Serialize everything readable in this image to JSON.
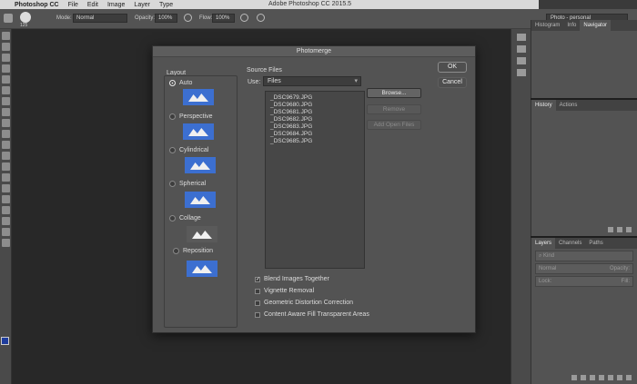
{
  "menubar": {
    "app_name": "Photoshop CC",
    "items": [
      "File",
      "Edit",
      "Image",
      "Layer",
      "Type"
    ],
    "window_title": "Adobe Photoshop CC 2015.5"
  },
  "options_bar": {
    "brush_size": "125",
    "mode_label": "Mode:",
    "mode_value": "Normal",
    "opacity_label": "Opacity:",
    "opacity_value": "100%",
    "flow_label": "Flow:",
    "flow_value": "100%",
    "workspace": "Photo - personal"
  },
  "right_panels": {
    "top_tabs": [
      "Histogram",
      "Info",
      "Navigator"
    ],
    "mid_tabs": [
      "History",
      "Actions"
    ],
    "layer_tabs": [
      "Layers",
      "Channels",
      "Paths"
    ],
    "kind_placeholder": "Kind",
    "blend_mode": "Normal",
    "opacity_label": "Opacity:",
    "lock_label": "Lock:",
    "fill_label": "Fill:"
  },
  "dialog": {
    "title": "Photomerge",
    "layout_label": "Layout",
    "layout_options": [
      "Auto",
      "Perspective",
      "Cylindrical",
      "Spherical",
      "Collage",
      "Reposition"
    ],
    "selected_layout": "Auto",
    "source_label": "Source Files",
    "use_label": "Use:",
    "use_value": "Files",
    "files": [
      "_DSC9679.JPG",
      "_DSC9680.JPG",
      "_DSC9681.JPG",
      "_DSC9682.JPG",
      "_DSC9683.JPG",
      "_DSC9684.JPG",
      "_DSC9685.JPG"
    ],
    "browse_label": "Browse...",
    "remove_label": "Remove",
    "add_open_label": "Add Open Files",
    "ok_label": "OK",
    "cancel_label": "Cancel",
    "checkboxes": [
      {
        "label": "Blend Images Together",
        "checked": true
      },
      {
        "label": "Vignette Removal",
        "checked": false
      },
      {
        "label": "Geometric Distortion Correction",
        "checked": false
      },
      {
        "label": "Content Aware Fill Transparent Areas",
        "checked": false
      }
    ]
  },
  "colors": {
    "dialog_bg": "#535353",
    "thumbnail_blue": "#3c6fd0",
    "foreground_swatch": "#1f3d9c",
    "background_swatch": "#d01818"
  }
}
